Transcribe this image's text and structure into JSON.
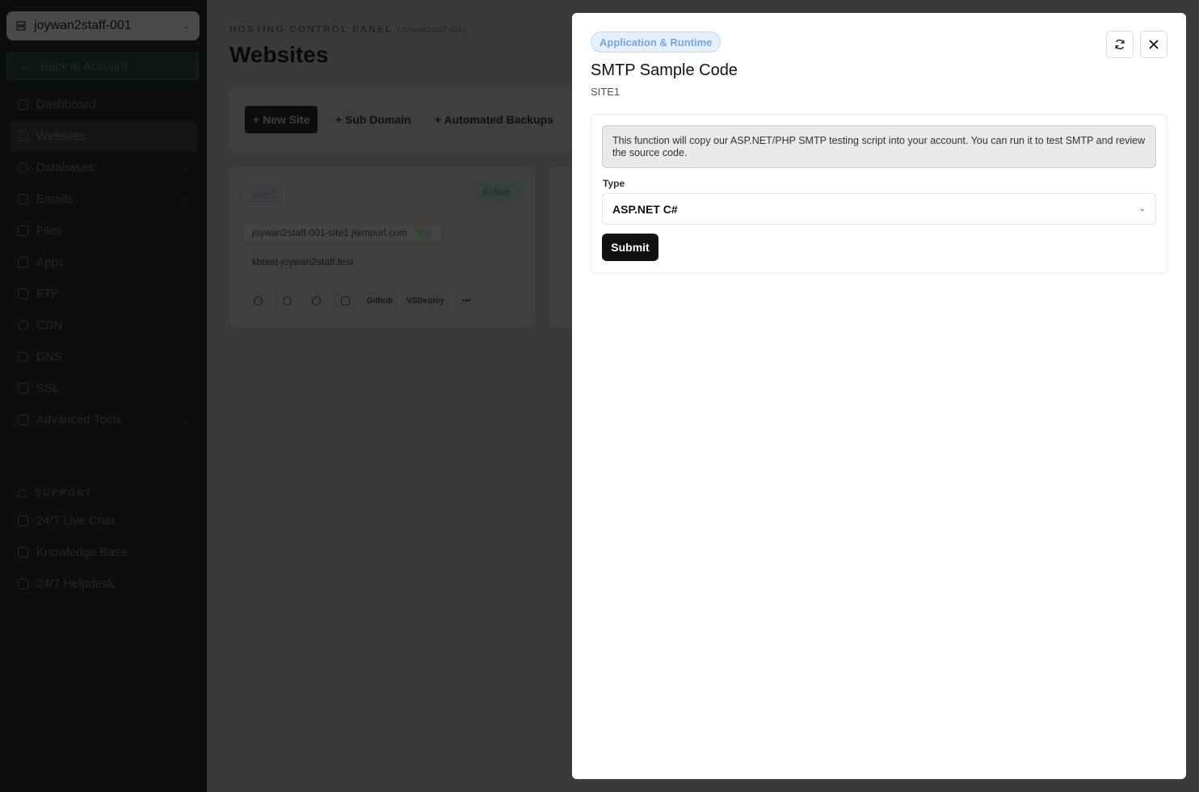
{
  "sidebar": {
    "account": "joywan2staff-001",
    "back": "Back to Account",
    "items": [
      {
        "label": "Dashboard",
        "has_chevron": false
      },
      {
        "label": "Websites",
        "has_chevron": false,
        "active": true
      },
      {
        "label": "Databases",
        "has_chevron": true
      },
      {
        "label": "Emails",
        "has_chevron": true
      },
      {
        "label": "Files",
        "has_chevron": false
      },
      {
        "label": "Apps",
        "has_chevron": false
      },
      {
        "label": "FTP",
        "has_chevron": false
      },
      {
        "label": "CDN",
        "has_chevron": false
      },
      {
        "label": "DNS",
        "has_chevron": false
      },
      {
        "label": "SSL",
        "has_chevron": false
      },
      {
        "label": "Advanced Tools",
        "has_chevron": true
      }
    ],
    "support_title": "SUPPORT",
    "support_items": [
      {
        "label": "24/7 Live Chat"
      },
      {
        "label": "Knowledge Base"
      },
      {
        "label": "24/7 Helpdesk"
      }
    ]
  },
  "main": {
    "crumb": "HOSTING CONTROL PANEL",
    "crumb_sub": "(Joywan2staff-001)",
    "title": "Websites",
    "toolbar": {
      "new_site": "+ New Site",
      "sub_domain": "+ Sub Domain",
      "automated_backups": "+ Automated Backups"
    },
    "site": {
      "name": "site1",
      "status": "Active",
      "domains": [
        "joywan2staff-001-site1.jtempurl.com",
        "kbtest-joywan2staff.test"
      ],
      "ssl": "SSL",
      "actions": [
        "Github",
        "VSDeploy",
        "•••"
      ]
    }
  },
  "modal": {
    "category": "Application & Runtime",
    "title": "SMTP Sample Code",
    "subtitle": "SITE1",
    "info": "This function will copy our ASP.NET/PHP SMTP testing script into your account. You can run it to test SMTP and review the source code.",
    "type_label": "Type",
    "type_value": "ASP.NET C#",
    "submit": "Submit",
    "colors": {
      "badge_text": "#73a6e3",
      "badge_bg": "#e6f0fb",
      "primary": "#111111"
    }
  }
}
